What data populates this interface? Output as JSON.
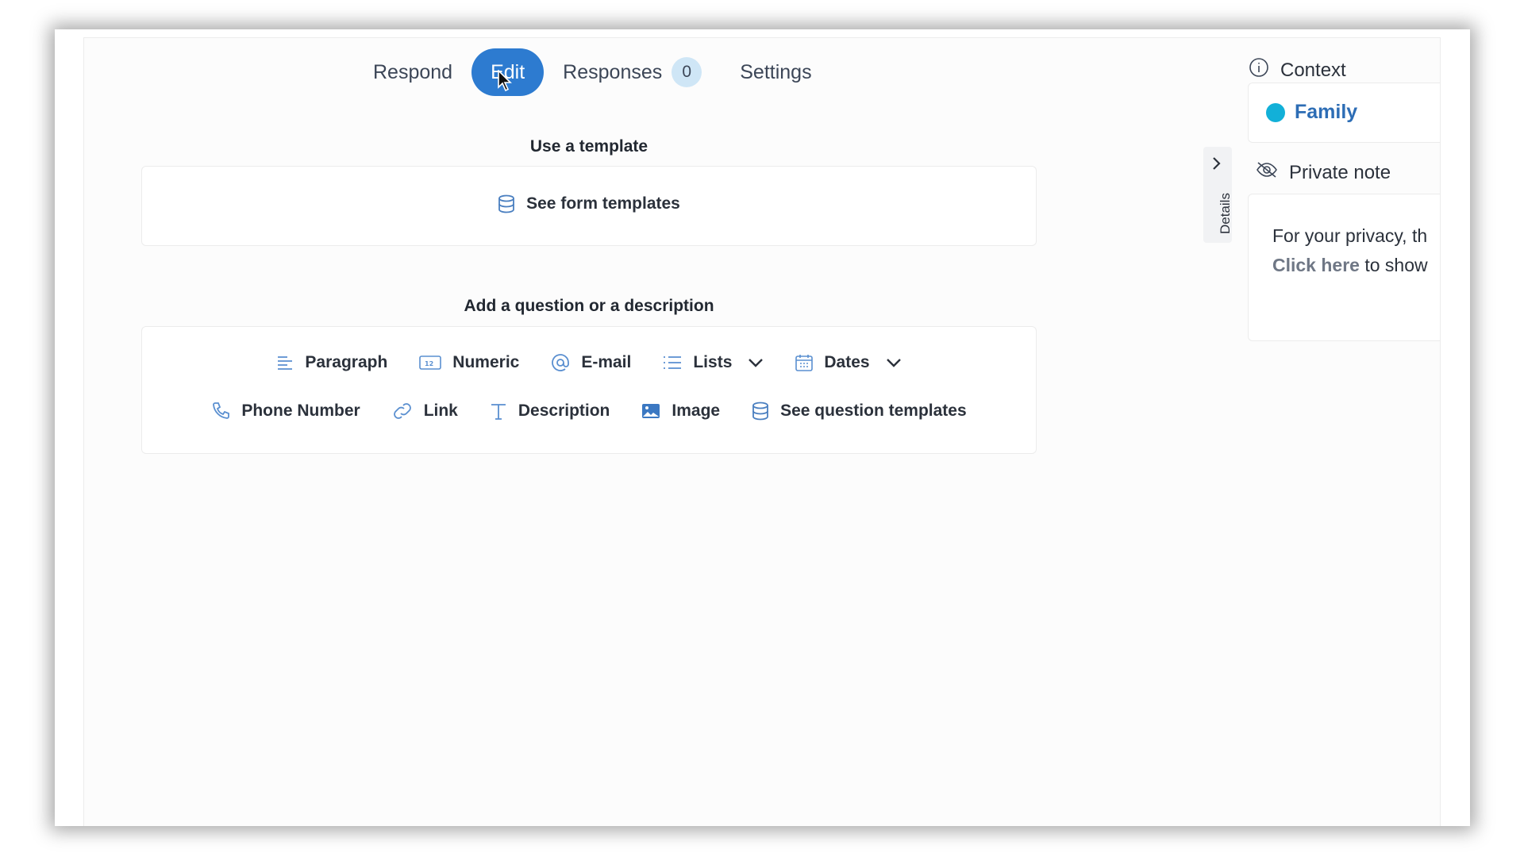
{
  "tabs": {
    "respond": "Respond",
    "edit": "Edit",
    "responses": "Responses",
    "responses_count": "0",
    "settings": "Settings"
  },
  "template_section": {
    "title": "Use a template",
    "button": "See form templates"
  },
  "question_section": {
    "title": "Add a question or a description",
    "row1": {
      "paragraph": "Paragraph",
      "numeric": "Numeric",
      "email": "E-mail",
      "lists": "Lists",
      "dates": "Dates"
    },
    "row2": {
      "phone": "Phone Number",
      "link": "Link",
      "description": "Description",
      "image": "Image",
      "templates": "See question templates"
    }
  },
  "details_handle": {
    "label": "Details"
  },
  "right_panel": {
    "context_label": "Context",
    "context_value": "Family",
    "private_note_label": "Private note",
    "privacy_text": "For your privacy, th",
    "click_here": "Click here",
    "to_show": " to show"
  },
  "colors": {
    "accent": "#2d7bd0",
    "badge": "#cfe6f6",
    "family_dot": "#12b0d8",
    "family_text": "#2d6db5"
  },
  "icons": {
    "template": "database-icon",
    "paragraph": "paragraph-icon",
    "numeric": "numeric-icon",
    "email": "at-icon",
    "lists": "list-icon",
    "dates": "calendar-icon",
    "phone": "phone-icon",
    "link": "link-icon",
    "description": "text-icon",
    "image": "image-icon",
    "question_templates": "database-icon",
    "context": "info-icon",
    "private_note": "eye-off-icon"
  }
}
